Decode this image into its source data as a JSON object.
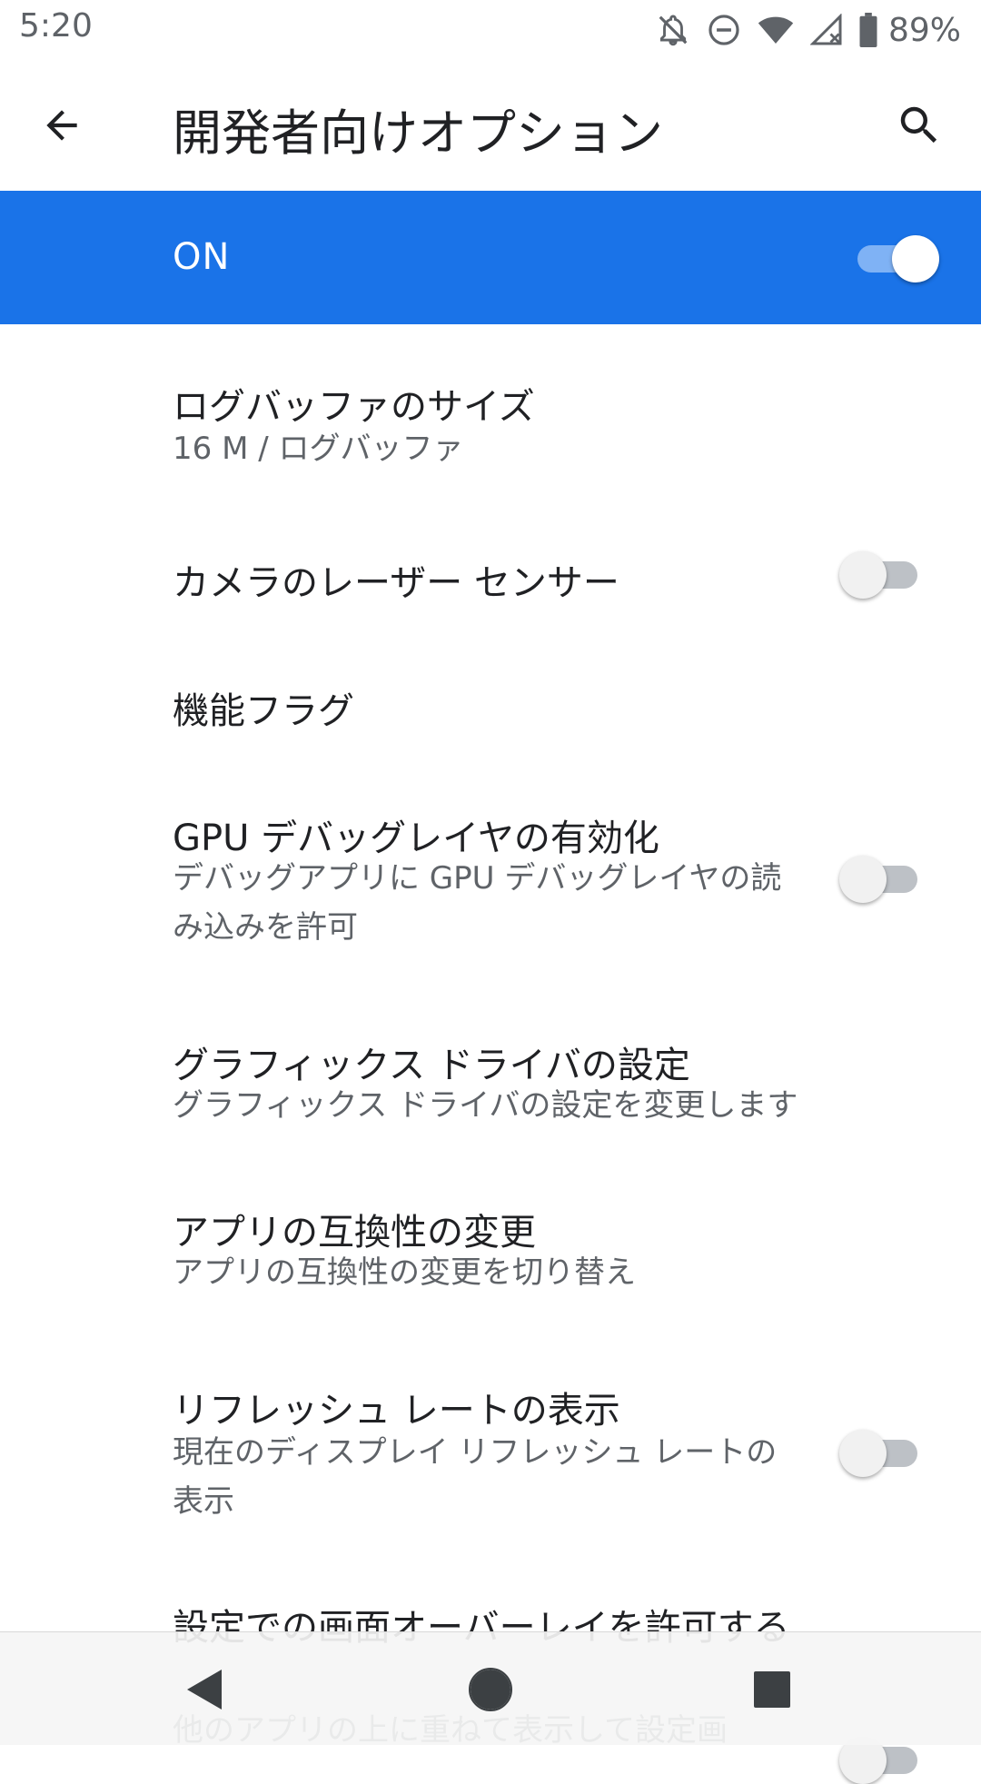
{
  "status_bar": {
    "time": "5:20",
    "battery": "89%",
    "icons": [
      "notifications-off-icon",
      "do-not-disturb-icon",
      "wifi-icon",
      "cellular-no-signal-icon",
      "battery-icon"
    ]
  },
  "toolbar": {
    "title": "開発者向けオプション",
    "back_icon": "arrow-back-icon",
    "search_icon": "search-icon"
  },
  "master": {
    "label": "ON",
    "checked": true,
    "color": "#1a73e8"
  },
  "items": [
    {
      "title": "ログバッファのサイズ",
      "summary": "16 M / ログバッファ"
    },
    {
      "title": "カメラのレーザー センサー",
      "toggle": false
    },
    {
      "title": "機能フラグ"
    },
    {
      "title": "GPU デバッグレイヤの有効化",
      "summary": "デバッグアプリに GPU デバッグレイヤの読み込みを許可",
      "toggle": false
    },
    {
      "title": "グラフィックス ドライバの設定",
      "summary": "グラフィックス ドライバの設定を変更します"
    },
    {
      "title": "アプリの互換性の変更",
      "summary": "アプリの互換性の変更を切り替え"
    },
    {
      "title": "リフレッシュ レートの表示",
      "summary": "現在のディスプレイ リフレッシュ レートの表示",
      "toggle": false
    },
    {
      "title": "設定での画面オーバーレイを許可する",
      "summary": "他のアプリの上に重ねて表示して設定画",
      "toggle": false
    }
  ],
  "nav": {
    "back_icon": "nav-back-icon",
    "home_icon": "nav-home-icon",
    "recents_icon": "nav-recents-icon"
  }
}
